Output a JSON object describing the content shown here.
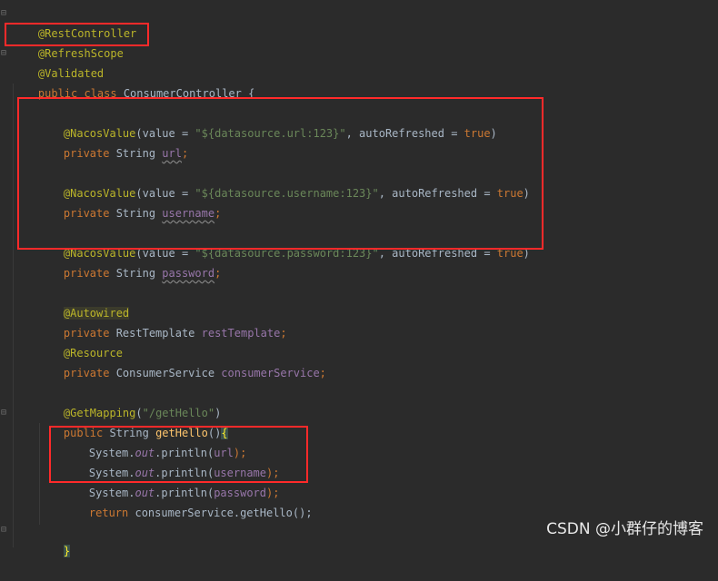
{
  "code": {
    "l1": "@RestController",
    "l2": "@RefreshScope",
    "l3": "@Validated",
    "l4_kw": "public class ",
    "l4_name": "ConsumerController {",
    "f1_ann": "@NacosValue",
    "f1_a": "(value = ",
    "f1_str": "\"${datasource.url:123}\"",
    "f1_b": ", autoRefreshed = ",
    "f1_bool": "true",
    "f1_c": ")",
    "d1_kw": "private ",
    "d1_type": "String ",
    "d1_name": "url",
    "d1_semi": ";",
    "f2_ann": "@NacosValue",
    "f2_a": "(value = ",
    "f2_str": "\"${datasource.username:123}\"",
    "f2_b": ", autoRefreshed = ",
    "f2_bool": "true",
    "f2_c": ")",
    "d2_kw": "private ",
    "d2_type": "String ",
    "d2_name": "username",
    "d2_semi": ";",
    "f3_ann": "@NacosValue",
    "f3_a": "(value = ",
    "f3_str": "\"${datasource.password:123}\"",
    "f3_b": ", autoRefreshed = ",
    "f3_bool": "true",
    "f3_c": ")",
    "d3_kw": "private ",
    "d3_type": "String ",
    "d3_name": "password",
    "d3_semi": ";",
    "aw_ann": "@Autowired",
    "d4_kw": "private ",
    "d4_type": "RestTemplate ",
    "d4_name": "restTemplate",
    "d4_semi": ";",
    "rs_ann": "@Resource",
    "d5_kw": "private ",
    "d5_type": "ConsumerService ",
    "d5_name": "consumerService",
    "d5_semi": ";",
    "gm_ann": "@GetMapping",
    "gm_a": "(",
    "gm_str": "\"/getHello\"",
    "gm_c": ")",
    "m_kw": "public ",
    "m_type": "String ",
    "m_name": "getHello",
    "m_paren": "()",
    "m_brace": "{",
    "p1_a": "System.",
    "p1_out": "out",
    "p1_b": ".println(",
    "p1_arg": "url",
    "p1_c": ");",
    "p2_a": "System.",
    "p2_out": "out",
    "p2_b": ".println(",
    "p2_arg": "username",
    "p2_c": ");",
    "p3_a": "System.",
    "p3_out": "out",
    "p3_b": ".println(",
    "p3_arg": "password",
    "p3_c": ");",
    "r_kw": "return ",
    "r_a": "consumerService",
    "r_b": ".getHello();",
    "end_brace": "}"
  },
  "watermark": "CSDN @小群仔的博客",
  "colors": {
    "background": "#2b2b2b",
    "annotation": "#bbb529",
    "keyword": "#cc7832",
    "string": "#6a8759",
    "field": "#9876aa",
    "highlight_box": "#ff2a2a"
  }
}
